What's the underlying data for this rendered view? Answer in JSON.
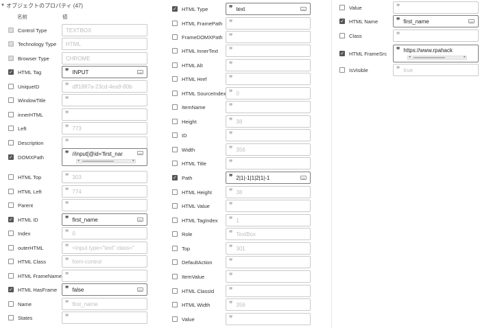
{
  "header": {
    "title": "オブジェクトのプロパティ (47)"
  },
  "columns": {
    "name": "名前",
    "value": "値"
  },
  "panel1": [
    {
      "label": "Control Type",
      "check": "disabled",
      "value": "TEXTBOX",
      "quote": false,
      "placeholder": true,
      "icon": false
    },
    {
      "label": "Technology Type",
      "check": "disabled",
      "value": "HTML",
      "quote": false,
      "placeholder": true,
      "icon": false
    },
    {
      "label": "Browser Type",
      "check": "disabled",
      "value": "CHROME",
      "quote": false,
      "placeholder": true,
      "icon": false
    },
    {
      "label": "HTML Tag",
      "check": "checked",
      "value": "INPUT",
      "quote": true,
      "placeholder": false,
      "icon": true
    },
    {
      "label": "UniqueID",
      "check": "unchecked",
      "value": "dff1887a-23cd-4ea9-80b",
      "quote": true,
      "placeholder": true,
      "icon": false
    },
    {
      "label": "WindowTitle",
      "check": "unchecked",
      "value": "",
      "quote": true,
      "placeholder": true,
      "icon": false
    },
    {
      "label": "innerHTML",
      "check": "unchecked",
      "value": "",
      "quote": true,
      "placeholder": true,
      "icon": false
    },
    {
      "label": "Left",
      "check": "unchecked",
      "value": "773",
      "quote": true,
      "placeholder": true,
      "icon": false
    },
    {
      "label": "Description",
      "check": "unchecked",
      "value": "",
      "quote": true,
      "placeholder": true,
      "icon": false
    },
    {
      "label": "DOMXPath",
      "check": "checked",
      "value": "//input[@id='first_nar",
      "quote": true,
      "placeholder": false,
      "icon": true,
      "tall": true
    },
    {
      "label": "HTML Top",
      "check": "unchecked",
      "value": "303",
      "quote": true,
      "placeholder": true,
      "icon": false
    },
    {
      "label": "HTML Left",
      "check": "unchecked",
      "value": "774",
      "quote": true,
      "placeholder": true,
      "icon": false
    },
    {
      "label": "Parent",
      "check": "unchecked",
      "value": "",
      "quote": true,
      "placeholder": true,
      "icon": false
    },
    {
      "label": "HTML ID",
      "check": "checked",
      "value": "first_name",
      "quote": true,
      "placeholder": false,
      "icon": true
    },
    {
      "label": "Index",
      "check": "unchecked",
      "value": "0",
      "quote": true,
      "placeholder": true,
      "icon": false
    },
    {
      "label": "outerHTML",
      "check": "unchecked",
      "value": "<input type=\"text\" class=\"",
      "quote": true,
      "placeholder": true,
      "icon": false
    },
    {
      "label": "HTML Class",
      "check": "unchecked",
      "value": "form-control",
      "quote": true,
      "placeholder": true,
      "icon": false
    },
    {
      "label": "HTML FrameName",
      "check": "unchecked",
      "value": "",
      "quote": true,
      "placeholder": true,
      "icon": false
    },
    {
      "label": "HTML HasFrame",
      "check": "checked",
      "value": "false",
      "quote": true,
      "placeholder": false,
      "icon": true
    },
    {
      "label": "Name",
      "check": "unchecked",
      "value": "first_name",
      "quote": true,
      "placeholder": true,
      "icon": false
    },
    {
      "label": "States",
      "check": "unchecked",
      "value": "",
      "quote": true,
      "placeholder": true,
      "icon": false
    }
  ],
  "panel2": [
    {
      "label": "HTML Type",
      "check": "checked",
      "value": "text",
      "quote": true,
      "placeholder": false,
      "icon": true
    },
    {
      "label": "HTML FramePath",
      "check": "unchecked",
      "value": "",
      "quote": true,
      "placeholder": true,
      "icon": false
    },
    {
      "label": "FrameDOMXPath",
      "check": "unchecked",
      "value": "",
      "quote": true,
      "placeholder": true,
      "icon": false
    },
    {
      "label": "HTML InnerText",
      "check": "unchecked",
      "value": "",
      "quote": true,
      "placeholder": true,
      "icon": false
    },
    {
      "label": "HTML Alt",
      "check": "unchecked",
      "value": "",
      "quote": true,
      "placeholder": true,
      "icon": false
    },
    {
      "label": "HTML Href",
      "check": "unchecked",
      "value": "",
      "quote": true,
      "placeholder": true,
      "icon": false
    },
    {
      "label": "HTML SourceIndex",
      "check": "unchecked",
      "value": "0",
      "quote": true,
      "placeholder": true,
      "icon": false
    },
    {
      "label": "ItemName",
      "check": "unchecked",
      "value": "",
      "quote": true,
      "placeholder": true,
      "icon": false
    },
    {
      "label": "Height",
      "check": "unchecked",
      "value": "38",
      "quote": true,
      "placeholder": true,
      "icon": false
    },
    {
      "label": "ID",
      "check": "unchecked",
      "value": "",
      "quote": true,
      "placeholder": true,
      "icon": false
    },
    {
      "label": "Width",
      "check": "unchecked",
      "value": "356",
      "quote": true,
      "placeholder": true,
      "icon": false
    },
    {
      "label": "HTML Title",
      "check": "unchecked",
      "value": "",
      "quote": true,
      "placeholder": true,
      "icon": false
    },
    {
      "label": "Path",
      "check": "checked",
      "value": "2|1|-1|1|2|1|-1",
      "quote": true,
      "placeholder": false,
      "icon": true
    },
    {
      "label": "HTML Height",
      "check": "unchecked",
      "value": "38",
      "quote": true,
      "placeholder": true,
      "icon": false
    },
    {
      "label": "HTML Value",
      "check": "unchecked",
      "value": "",
      "quote": true,
      "placeholder": true,
      "icon": false
    },
    {
      "label": "HTML TagIndex",
      "check": "unchecked",
      "value": "1",
      "quote": true,
      "placeholder": true,
      "icon": false
    },
    {
      "label": "Role",
      "check": "unchecked",
      "value": "TextBox",
      "quote": true,
      "placeholder": true,
      "icon": false
    },
    {
      "label": "Top",
      "check": "unchecked",
      "value": "301",
      "quote": true,
      "placeholder": true,
      "icon": false
    },
    {
      "label": "DefaultAction",
      "check": "unchecked",
      "value": "",
      "quote": true,
      "placeholder": true,
      "icon": false
    },
    {
      "label": "ItemValue",
      "check": "unchecked",
      "value": "",
      "quote": true,
      "placeholder": true,
      "icon": false
    },
    {
      "label": "HTML ClassId",
      "check": "unchecked",
      "value": "",
      "quote": true,
      "placeholder": true,
      "icon": false
    },
    {
      "label": "HTML Width",
      "check": "unchecked",
      "value": "356",
      "quote": true,
      "placeholder": true,
      "icon": false
    },
    {
      "label": "Value",
      "check": "unchecked",
      "value": "",
      "quote": true,
      "placeholder": true,
      "icon": false
    }
  ],
  "panel3": [
    {
      "label": "Value",
      "check": "unchecked",
      "value": "",
      "quote": true,
      "placeholder": true,
      "icon": false
    },
    {
      "label": "HTML Name",
      "check": "checked",
      "value": "first_name",
      "quote": true,
      "placeholder": false,
      "icon": true
    },
    {
      "label": "Class",
      "check": "unchecked",
      "value": "",
      "quote": true,
      "placeholder": true,
      "icon": false
    },
    {
      "label": "HTML FrameSrc",
      "check": "checked",
      "value": "https://www.rpahack",
      "quote": true,
      "placeholder": false,
      "icon": false,
      "tall": true
    },
    {
      "label": "IsVisible",
      "check": "unchecked",
      "value": "true",
      "quote": true,
      "placeholder": true,
      "icon": false
    }
  ],
  "icons": {
    "quote": "❞",
    "check": "✓",
    "expr": "(x)",
    "left": "◂",
    "right": "▸"
  }
}
